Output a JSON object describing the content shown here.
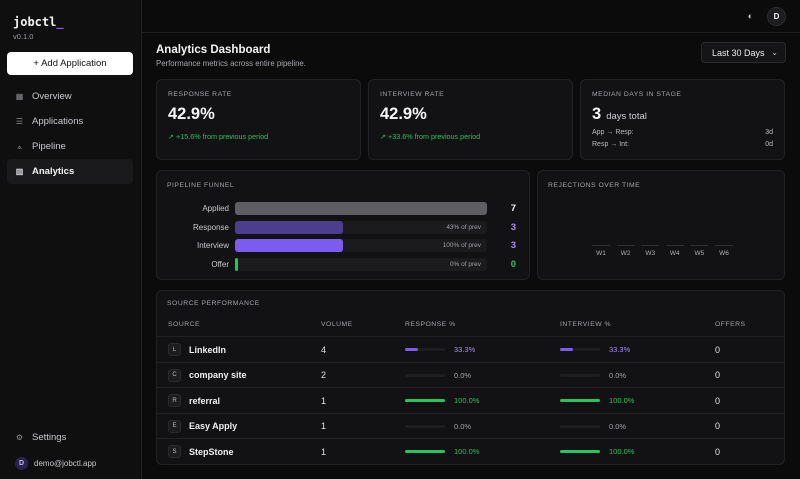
{
  "sidebar": {
    "brand": "jobctl",
    "brand_cursor": "_",
    "version": "v0.1.0",
    "add_button": "+ Add Application",
    "nav": [
      {
        "label": "Overview",
        "icon": "grid-icon"
      },
      {
        "label": "Applications",
        "icon": "list-icon"
      },
      {
        "label": "Pipeline",
        "icon": "pipeline-icon"
      },
      {
        "label": "Analytics",
        "icon": "bar-chart-icon",
        "active": true
      }
    ],
    "settings_label": "Settings",
    "user_initial": "D",
    "user_email": "demo@jobctl.app"
  },
  "topbar": {
    "theme_icon": "contrast-icon",
    "avatar_initial": "D"
  },
  "header": {
    "title": "Analytics Dashboard",
    "subtitle": "Performance metrics across entire pipeline.",
    "range_label": "Last 30 Days"
  },
  "metrics": {
    "response": {
      "label": "Response Rate",
      "value": "42.9%",
      "trend": "↗ +15.6% from previous period"
    },
    "interview": {
      "label": "Interview Rate",
      "value": "42.9%",
      "trend": "↗ +33.6% from previous period"
    },
    "median": {
      "label": "Median Days in Stage",
      "value": "3",
      "unit": "days total",
      "rows": [
        {
          "label": "App → Resp:",
          "value": "3d"
        },
        {
          "label": "Resp → Int:",
          "value": "0d"
        }
      ]
    }
  },
  "funnel": {
    "title": "Pipeline Funnel",
    "stages": [
      {
        "label": "Applied",
        "value": "7",
        "fraction": 1.0,
        "pct": "",
        "color": "#5f5f63",
        "value_color": "#f2f2f4"
      },
      {
        "label": "Response",
        "value": "3",
        "fraction": 0.43,
        "pct": "43% of prev",
        "color": "#4c3d8f",
        "value_color": "#a78bfa"
      },
      {
        "label": "Interview",
        "value": "3",
        "fraction": 0.43,
        "pct": "100% of prev",
        "color": "#7c5cf0",
        "value_color": "#a78bfa"
      },
      {
        "label": "Offer",
        "value": "0",
        "fraction": 0.0,
        "pct": "0% of prev",
        "color": "#22c55e",
        "value_color": "#22c55e"
      }
    ]
  },
  "rejections": {
    "title": "Rejections Over Time",
    "weeks": [
      "W1",
      "W2",
      "W3",
      "W4",
      "W5",
      "W6"
    ]
  },
  "sources": {
    "title": "Source Performance",
    "columns": [
      "Source",
      "Volume",
      "Response %",
      "Interview %",
      "Offers"
    ],
    "rows": [
      {
        "badge": "L",
        "name": "LinkedIn",
        "volume": "4",
        "response": "33.3%",
        "response_frac": 0.333,
        "interview": "33.3%",
        "interview_frac": 0.333,
        "offers": "0",
        "color": "#7c5cf0",
        "text_color": "#a78bfa"
      },
      {
        "badge": "C",
        "name": "company site",
        "volume": "2",
        "response": "0.0%",
        "response_frac": 0,
        "interview": "0.0%",
        "interview_frac": 0,
        "offers": "0",
        "color": "#7c5cf0",
        "text_color": "#a3a3aa"
      },
      {
        "badge": "R",
        "name": "referral",
        "volume": "1",
        "response": "100.0%",
        "response_frac": 1,
        "interview": "100.0%",
        "interview_frac": 1,
        "offers": "0",
        "color": "#22c55e",
        "text_color": "#22c55e"
      },
      {
        "badge": "E",
        "name": "Easy Apply",
        "volume": "1",
        "response": "0.0%",
        "response_frac": 0,
        "interview": "0.0%",
        "interview_frac": 0,
        "offers": "0",
        "color": "#7c5cf0",
        "text_color": "#a3a3aa"
      },
      {
        "badge": "S",
        "name": "StepStone",
        "volume": "1",
        "response": "100.0%",
        "response_frac": 1,
        "interview": "100.0%",
        "interview_frac": 1,
        "offers": "0",
        "color": "#22c55e",
        "text_color": "#22c55e"
      }
    ]
  }
}
